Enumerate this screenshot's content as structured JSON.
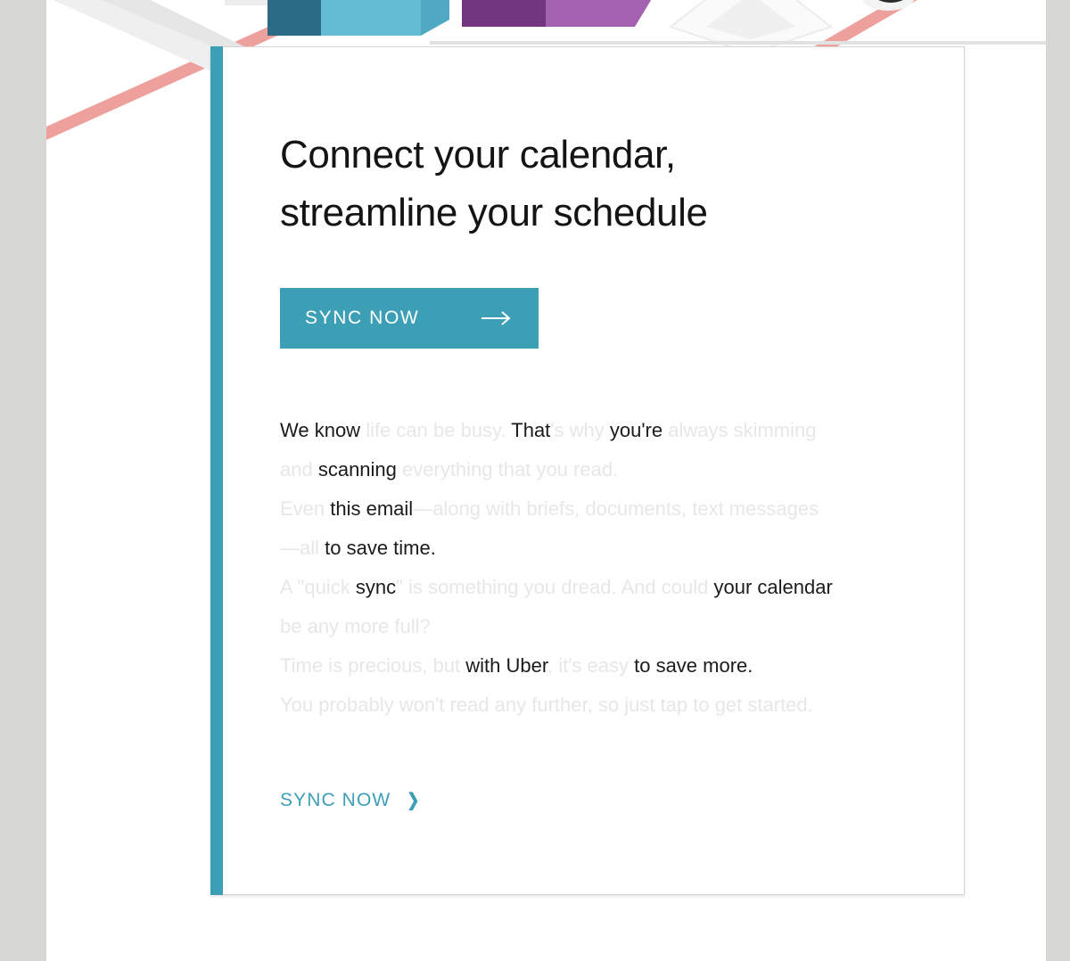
{
  "theme": {
    "accent_teal": "#3d9fb5",
    "page_margin_gray": "#d7d7d5",
    "card_background": "#ffffff",
    "card_border": "#d6d6d6",
    "text_dark": "#1b1b1b",
    "text_faint": "#e7e7e7",
    "art_salmon": "#eda09c",
    "art_purple_dark": "#71367f",
    "art_purple_light": "#a461b0",
    "art_teal_light": "#6fc0d4",
    "art_teal_dark": "#2b6b86",
    "art_gray": "#e4e4e4"
  },
  "hero": {
    "alt": "isometric illustration of stacked blocks and diagonal lines"
  },
  "card": {
    "headline_line_1": "Connect your calendar,",
    "headline_line_2": "streamline your schedule",
    "cta": {
      "label": "SYNC NOW",
      "arrow_icon": "arrow-right-icon"
    },
    "body": [
      [
        {
          "text": "We know ",
          "tone": "dark"
        },
        {
          "text": "life can be busy. ",
          "tone": "faint"
        },
        {
          "text": "That",
          "tone": "dark"
        },
        {
          "text": "'s why ",
          "tone": "faint"
        },
        {
          "text": "you're ",
          "tone": "dark"
        },
        {
          "text": "always skimming and ",
          "tone": "faint"
        },
        {
          "text": "scanning ",
          "tone": "dark"
        },
        {
          "text": "everything that you read.",
          "tone": "faint"
        }
      ],
      [
        {
          "text": "Even ",
          "tone": "faint"
        },
        {
          "text": "this email",
          "tone": "dark"
        },
        {
          "text": "—along with briefs, documents, text messages—all ",
          "tone": "faint"
        },
        {
          "text": "to save time.",
          "tone": "dark"
        }
      ],
      [
        {
          "text": "A \"quick ",
          "tone": "faint"
        },
        {
          "text": "sync",
          "tone": "dark"
        },
        {
          "text": "\" is something you dread. And could ",
          "tone": "faint"
        },
        {
          "text": "your calendar ",
          "tone": "dark"
        },
        {
          "text": "be any more full?",
          "tone": "faint"
        }
      ],
      [
        {
          "text": "Time is precious, but ",
          "tone": "faint"
        },
        {
          "text": "with Uber",
          "tone": "dark"
        },
        {
          "text": ", it's easy ",
          "tone": "faint"
        },
        {
          "text": "to save more.",
          "tone": "dark"
        }
      ],
      [
        {
          "text": "You probably won't read any further, so just tap to get started.",
          "tone": "faint"
        }
      ]
    ],
    "secondary_link": {
      "label": "SYNC NOW",
      "chevron_icon": "chevron-right-icon"
    }
  }
}
